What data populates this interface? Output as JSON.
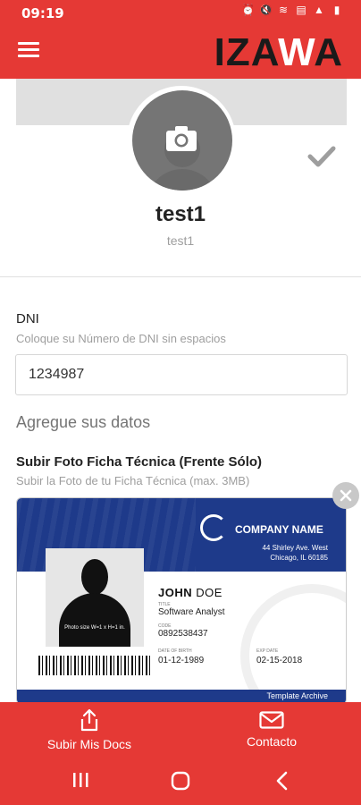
{
  "status_bar": {
    "time": "09:19",
    "icons": [
      "alarm-icon",
      "mute-icon",
      "wifi-icon",
      "lte-icon",
      "signal-icon",
      "battery-icon"
    ]
  },
  "header": {
    "logo_part1": "IZA",
    "logo_part2": "W",
    "logo_part3": "A",
    "accent_color": "#e53935"
  },
  "profile": {
    "name": "test1",
    "username": "test1"
  },
  "form": {
    "dni_label": "DNI",
    "dni_hint": "Coloque su Número de DNI sin espacios",
    "dni_value": "1234987",
    "section_title": "Agregue sus datos",
    "upload_label": "Subir Foto Ficha Técnica (Frente Sólo)",
    "upload_hint": "Subir la Foto de tu Ficha Técnica (max. 3MB)"
  },
  "id_card": {
    "company_name": "COMPANY NAME",
    "address_line1": "44 Shirley Ave. West",
    "address_line2": "Chicago, IL 60185",
    "photo_note": "Photo size W=1 x H=1 in.",
    "holder_first": "JOHN",
    "holder_last": "DOE",
    "title_label": "TITLE",
    "title_value": "Software Analyst",
    "code_label": "CODE",
    "code_value": "0892538437",
    "dob_label": "DATE OF BIRTH",
    "dob_value": "01-12-1989",
    "exp_label": "EXP DATE",
    "exp_value": "02-15-2018",
    "footer": "Template Archive"
  },
  "bottom_nav": {
    "upload_label": "Subir Mis Docs",
    "contact_label": "Contacto"
  }
}
